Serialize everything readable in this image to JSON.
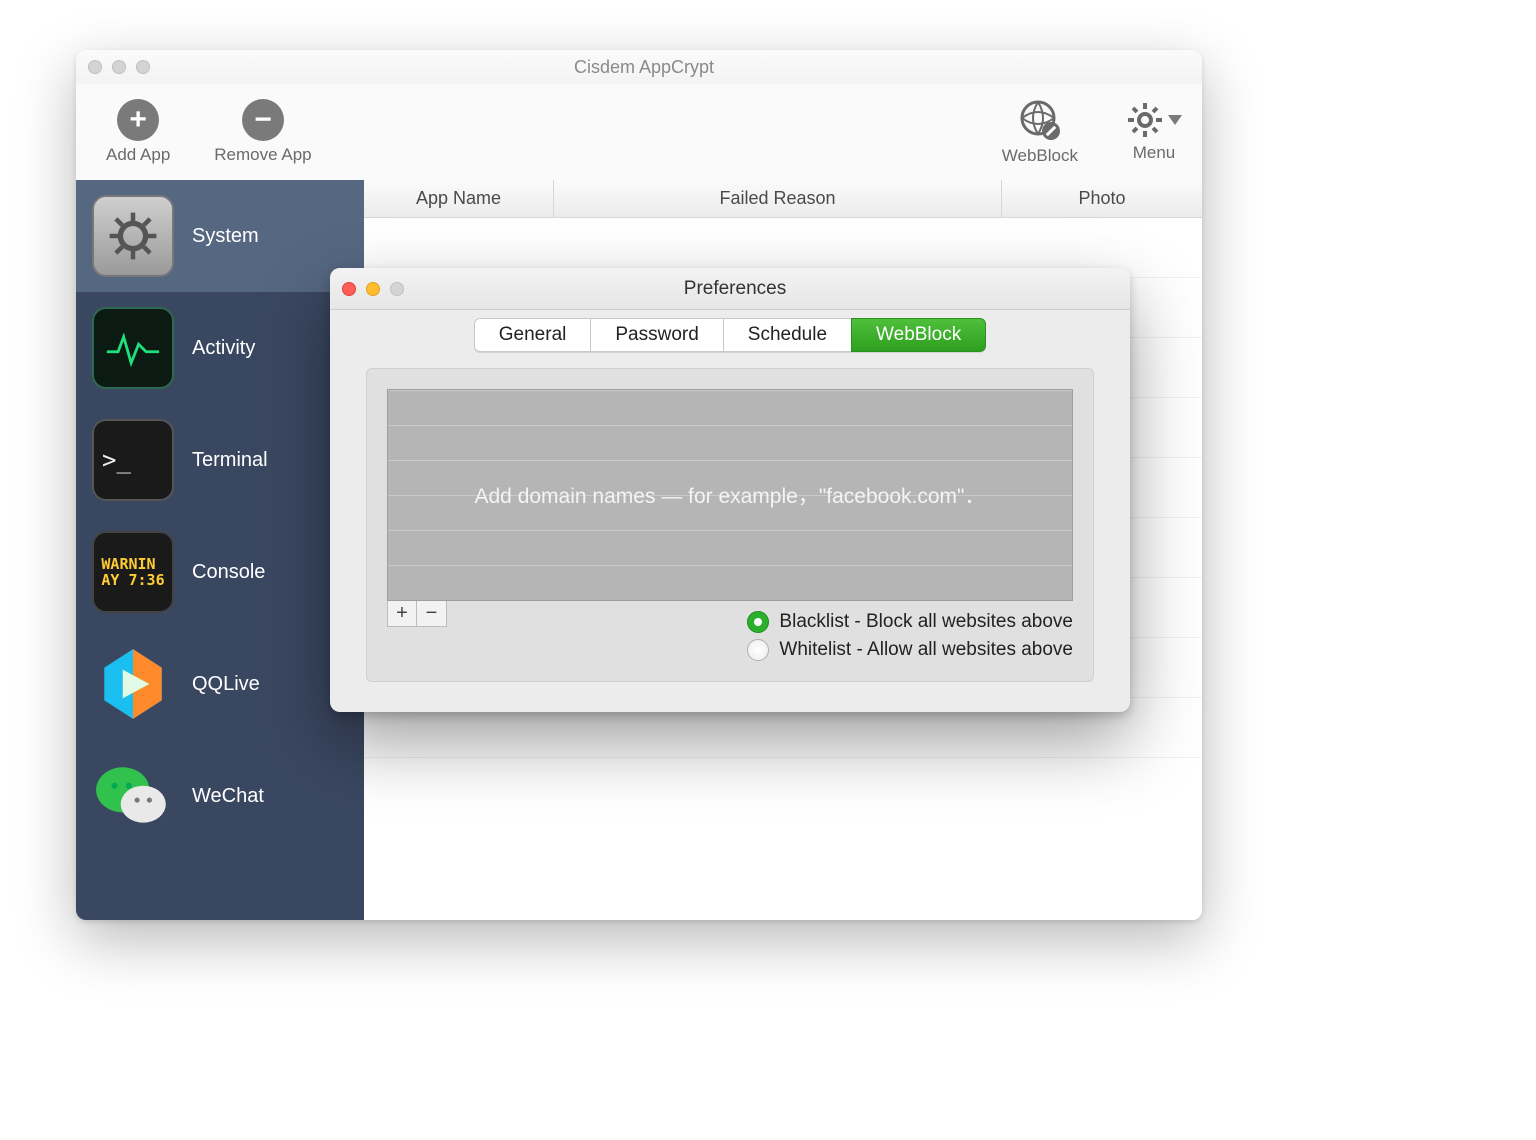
{
  "window": {
    "title": "Cisdem AppCrypt"
  },
  "toolbar": {
    "add_label": "Add App",
    "remove_label": "Remove App",
    "webblock_label": "WebBlock",
    "menu_label": "Menu"
  },
  "columns": {
    "app": "App Name",
    "reason": "Failed Reason",
    "photo": "Photo"
  },
  "sidebar": {
    "items": [
      {
        "label": "System",
        "selected": true,
        "icon": "gear"
      },
      {
        "label": "Activity",
        "selected": false,
        "icon": "activity"
      },
      {
        "label": "Terminal",
        "selected": false,
        "icon": "terminal"
      },
      {
        "label": "Console",
        "selected": false,
        "icon": "console",
        "badge": "WARNIN\nAY 7:36"
      },
      {
        "label": "QQLive",
        "selected": false,
        "icon": "qqlive"
      },
      {
        "label": "WeChat",
        "selected": false,
        "icon": "wechat"
      }
    ]
  },
  "preferences": {
    "title": "Preferences",
    "tabs": [
      "General",
      "Password",
      "Schedule",
      "WebBlock"
    ],
    "active_tab": "WebBlock",
    "domain_placeholder": "Add domain names — for example，\"facebook.com\"．",
    "radio_blacklist": "Blacklist - Block all websites above",
    "radio_whitelist": "Whitelist - Allow all websites above",
    "list_mode": "blacklist"
  }
}
